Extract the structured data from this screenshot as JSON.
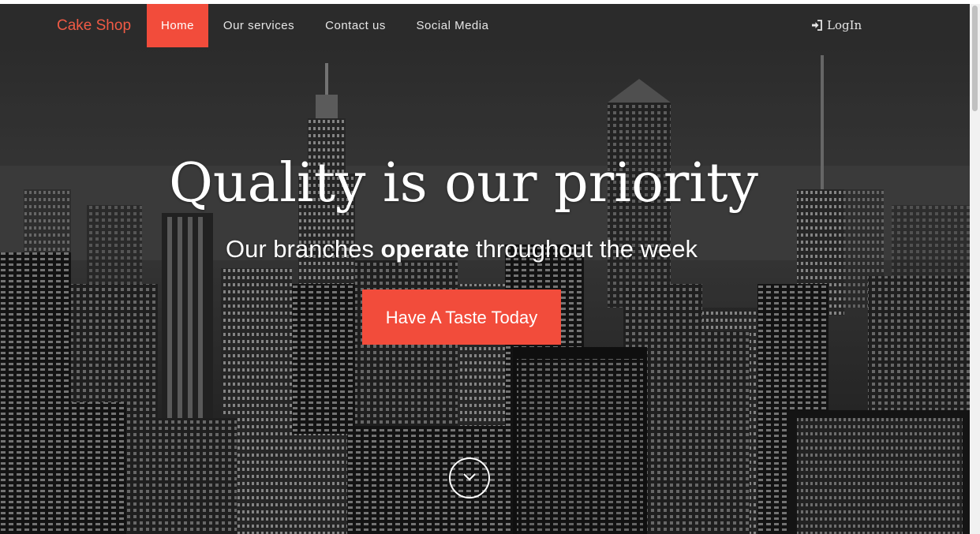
{
  "navbar": {
    "brand": "Cake Shop",
    "items": [
      {
        "label": "Home",
        "active": true
      },
      {
        "label": "Our services",
        "active": false
      },
      {
        "label": "Contact us",
        "active": false
      },
      {
        "label": "Social Media",
        "active": false
      }
    ],
    "login_label": "LogIn",
    "login_icon": "login-icon"
  },
  "hero": {
    "title": "Quality is our priority",
    "subtitle_pre": "Our branches ",
    "subtitle_bold": "operate",
    "subtitle_post": " throughout the week",
    "cta_label": "Have A Taste Today",
    "scroll_icon": "chevron-down-icon"
  },
  "colors": {
    "accent": "#f24c3b",
    "navbar_bg": "#2b2b2b",
    "brand": "#f05a45"
  }
}
